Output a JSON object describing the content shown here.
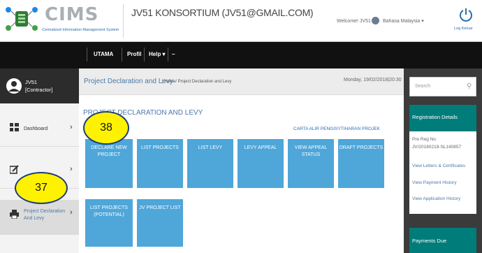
{
  "header": {
    "logo_text": "CIMS",
    "logo_tagline": "Centralized Information Management System",
    "org_title": "JV51 KONSORTIUM (JV51@GMAIL.COM)",
    "welcome": "Welcome! JV51 ▾",
    "language": "Bahasa Malaysia ▾",
    "logout": "Log Keluar"
  },
  "nav": {
    "items": [
      "UTAMA",
      "Profil",
      "Help ▾",
      "–"
    ]
  },
  "user": {
    "name": "JV51",
    "role": "[Contractor]"
  },
  "sidebar": {
    "items": [
      {
        "label": "Dashboard",
        "chevron": "›",
        "icon": "dashboard-icon"
      },
      {
        "label": "",
        "chevron": "›",
        "icon": "edit-icon"
      },
      {
        "label": "Project Declaration And Levy",
        "chevron": "›",
        "icon": "printer-icon"
      }
    ]
  },
  "page": {
    "heading": "Project Declaration and Levy",
    "breadcrumb": "| Home/ Project Declaration and Levy",
    "datetime": "Monday, 19/02/2018|20:30",
    "section_title": "PROJECT DECLARATION AND LEVY",
    "flowchart_link": "CARTA ALIR PENGISYTIHARAN PROJEK"
  },
  "tiles": {
    "row1": [
      "DECLARE NEW PROJECT",
      "LIST PROJECTS",
      "LIST LEVY",
      "LEVY APPEAL",
      "VIEW APPEAL STATUS",
      "DRAFT PROJECTS"
    ],
    "row2": [
      "LIST PROJECTS (POTENTIAL)",
      "JV PROJECT LIST"
    ]
  },
  "badges": {
    "b38": "38",
    "b37": "37"
  },
  "right": {
    "search_placeholder": "Search",
    "registration": {
      "title": "Registration Details",
      "pre_reg_label": "Pre Reg No",
      "pre_reg_no": "JV/20180219-SL140857",
      "links": [
        "View Letters & Certificates",
        "View Payment History",
        "View Application History"
      ]
    },
    "payments_title": "Payments Due"
  },
  "colors": {
    "accent": "#4ea6d9",
    "teal": "#007c7a",
    "badge": "#fff200",
    "nav_bg": "#111111"
  }
}
